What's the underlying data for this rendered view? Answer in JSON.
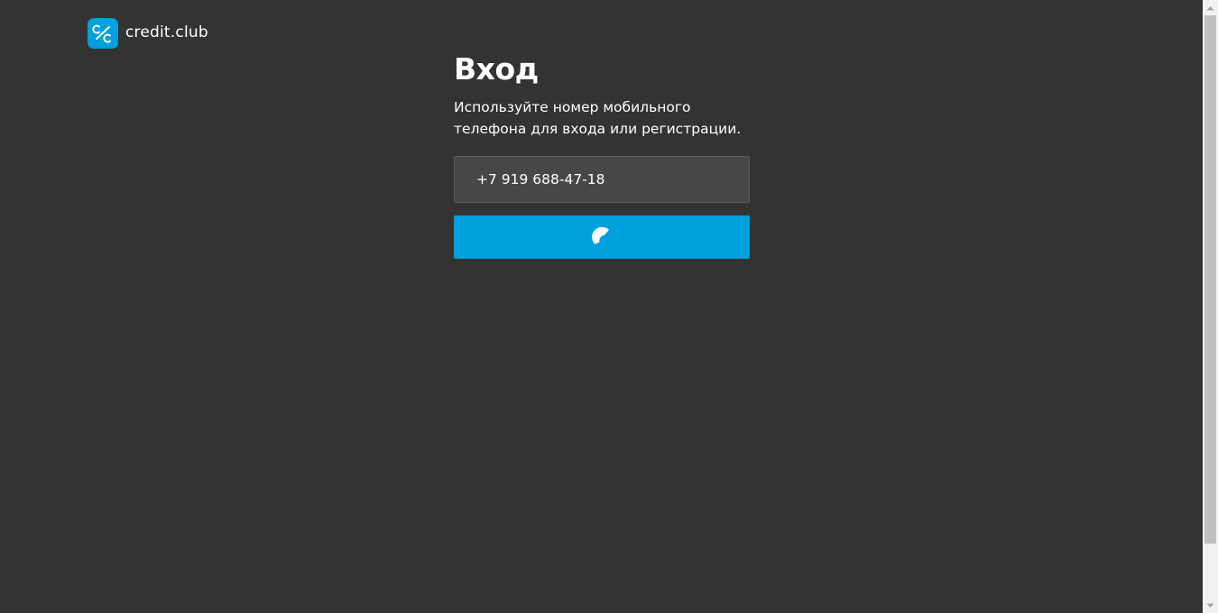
{
  "brand": {
    "name": "credit.club",
    "icon": "credit-club-logo-icon",
    "accent_color": "#00a0dc"
  },
  "login": {
    "title": "Вход",
    "subtitle_line1": "Используйте номер мобильного",
    "subtitle_line2": "телефона для входа или регистрации.",
    "phone_value": "+7 919 688-47-18",
    "submit_icon": "loading-spinner-icon"
  },
  "colors": {
    "background": "#333333",
    "input_background": "#474747",
    "button": "#00a0dc"
  }
}
